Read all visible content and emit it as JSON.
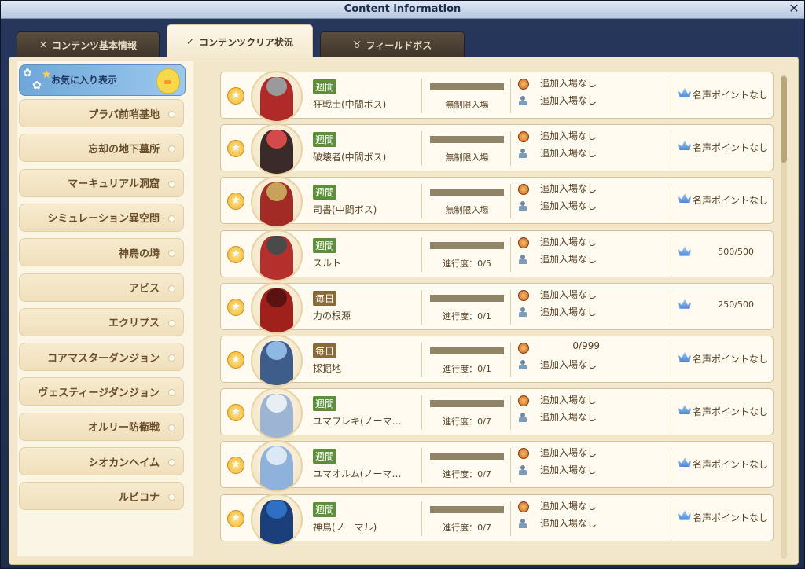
{
  "window": {
    "title": "Content information",
    "close_glyph": "✕"
  },
  "tabs": [
    {
      "label": "コンテンツ基本情報",
      "icon": "crossed-swords-icon",
      "glyph": "✕"
    },
    {
      "label": "コンテンツクリア状況",
      "icon": "check-icon",
      "glyph": "✓"
    },
    {
      "label": "フィールドボス",
      "icon": "horns-icon",
      "glyph": "♉"
    }
  ],
  "sidebar": {
    "favorite_label": "お気に入り表示",
    "items": [
      {
        "label": "プラバ前哨基地"
      },
      {
        "label": "忘却の地下墓所"
      },
      {
        "label": "マーキュリアル洞窟"
      },
      {
        "label": "シミュレーション異空間"
      },
      {
        "label": "神鳥の塒"
      },
      {
        "label": "アビス"
      },
      {
        "label": "エクリプス"
      },
      {
        "label": "コアマスターダンジョン"
      },
      {
        "label": "ヴェスティージダンジョン"
      },
      {
        "label": "オルリー防衛戦"
      },
      {
        "label": "シオカンヘイム"
      },
      {
        "label": "ルビコナ"
      }
    ]
  },
  "contents": [
    {
      "badge": "週間",
      "badge_color": "#5d8f3a",
      "name": "狂戦士(中間ボス)",
      "progress": "無制限入場",
      "progress_fraction": 0,
      "entry1": "追加入場なし",
      "entry2": "追加入場なし",
      "fame": "名声ポイントなし",
      "portrait_colors": [
        "#9a9a9a",
        "#b02a2a"
      ]
    },
    {
      "badge": "週間",
      "badge_color": "#5d8f3a",
      "name": "破壊者(中間ボス)",
      "progress": "無制限入場",
      "progress_fraction": 0,
      "entry1": "追加入場なし",
      "entry2": "追加入場なし",
      "fame": "名声ポイントなし",
      "portrait_colors": [
        "#d24a4a",
        "#3a2a2a"
      ]
    },
    {
      "badge": "週間",
      "badge_color": "#5d8f3a",
      "name": "司書(中間ボス)",
      "progress": "無制限入場",
      "progress_fraction": 0,
      "entry1": "追加入場なし",
      "entry2": "追加入場なし",
      "fame": "名声ポイントなし",
      "portrait_colors": [
        "#c8a25a",
        "#a32b25"
      ]
    },
    {
      "badge": "週間",
      "badge_color": "#5d8f3a",
      "name": "スルト",
      "progress": "進行度：0/5",
      "progress_fraction": 0,
      "entry1": "追加入場なし",
      "entry2": "追加入場なし",
      "fame": "500/500",
      "portrait_colors": [
        "#4a4a4a",
        "#b3302c"
      ]
    },
    {
      "badge": "毎日",
      "badge_color": "#8a6a3a",
      "name": "力の根源",
      "progress": "進行度：0/1",
      "progress_fraction": 0,
      "entry1": "追加入場なし",
      "entry2": "追加入場なし",
      "fame": "250/500",
      "portrait_colors": [
        "#5a1212",
        "#a0201c"
      ]
    },
    {
      "badge": "毎日",
      "badge_color": "#8a6a3a",
      "name": "採掘地",
      "progress": "進行度：0/1",
      "progress_fraction": 0,
      "entry1": "0/999",
      "entry2": "追加入場なし",
      "fame": "名声ポイントなし",
      "portrait_colors": [
        "#8fb7e4",
        "#3e5d8a"
      ]
    },
    {
      "badge": "週間",
      "badge_color": "#5d8f3a",
      "name": "ユマフレキ(ノーマ…",
      "progress": "進行度：0/7",
      "progress_fraction": 0,
      "entry1": "追加入場なし",
      "entry2": "追加入場なし",
      "fame": "名声ポイントなし",
      "portrait_colors": [
        "#e7eef6",
        "#9db4d4"
      ]
    },
    {
      "badge": "週間",
      "badge_color": "#5d8f3a",
      "name": "ユマオルム(ノーマ…",
      "progress": "進行度：0/7",
      "progress_fraction": 0,
      "entry1": "追加入場なし",
      "entry2": "追加入場なし",
      "fame": "名声ポイントなし",
      "portrait_colors": [
        "#dbe8f6",
        "#8fb2dc"
      ]
    },
    {
      "badge": "週間",
      "badge_color": "#5d8f3a",
      "name": "神鳥(ノーマル)",
      "progress": "進行度：0/7",
      "progress_fraction": 0,
      "entry1": "追加入場なし",
      "entry2": "追加入場なし",
      "fame": "名声ポイントなし",
      "portrait_colors": [
        "#2f6fc4",
        "#1b3f7a"
      ]
    }
  ]
}
